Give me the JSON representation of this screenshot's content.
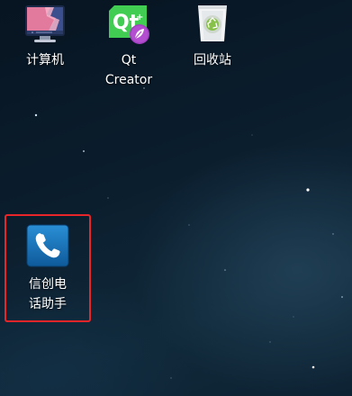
{
  "desktop": {
    "icons": [
      {
        "id": "computer",
        "label": "计算机",
        "icon": "computer-icon"
      },
      {
        "id": "qt-creator",
        "label": "Qt Creator",
        "label_lines": [
          "Qt",
          "Creator"
        ],
        "icon": "qt-creator-icon"
      },
      {
        "id": "trash",
        "label": "回收站",
        "icon": "recycle-bin-icon"
      },
      {
        "id": "phone-assistant",
        "label": "信创电话助手",
        "label_lines": [
          "信创电",
          "话助手"
        ],
        "icon": "phone-handset-icon",
        "highlighted": true
      }
    ]
  },
  "colors": {
    "highlight_border": "#e8262a",
    "qt_green": "#41cd52",
    "phone_blue": "#1a74b8"
  }
}
